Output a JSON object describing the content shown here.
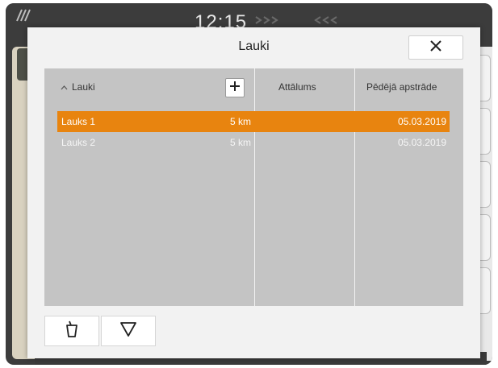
{
  "status_bar": {
    "clock": "12:15"
  },
  "dialog": {
    "title": "Lauki",
    "close_icon": "close-icon"
  },
  "list": {
    "columns": [
      {
        "label": "Lauki",
        "sort_icon": "sort-ascending-icon"
      },
      {
        "label": "Attālums"
      },
      {
        "label": "Pēdējā apstrāde"
      }
    ],
    "add_icon": "plus-icon",
    "rows": [
      {
        "name": "Lauks  1",
        "distance": "5 km",
        "last_processed": "05.03.2019",
        "selected": true
      },
      {
        "name": "Lauks  2",
        "distance": "5 km",
        "last_processed": "05.03.2019",
        "selected": false
      }
    ]
  },
  "toolbar": {
    "buttons": [
      {
        "icon": "delete-icon"
      },
      {
        "icon": "filter-icon"
      }
    ]
  },
  "colors": {
    "selection": "#e8840f",
    "panel": "#c4c4c4",
    "dialog": "#f2f2f2"
  }
}
